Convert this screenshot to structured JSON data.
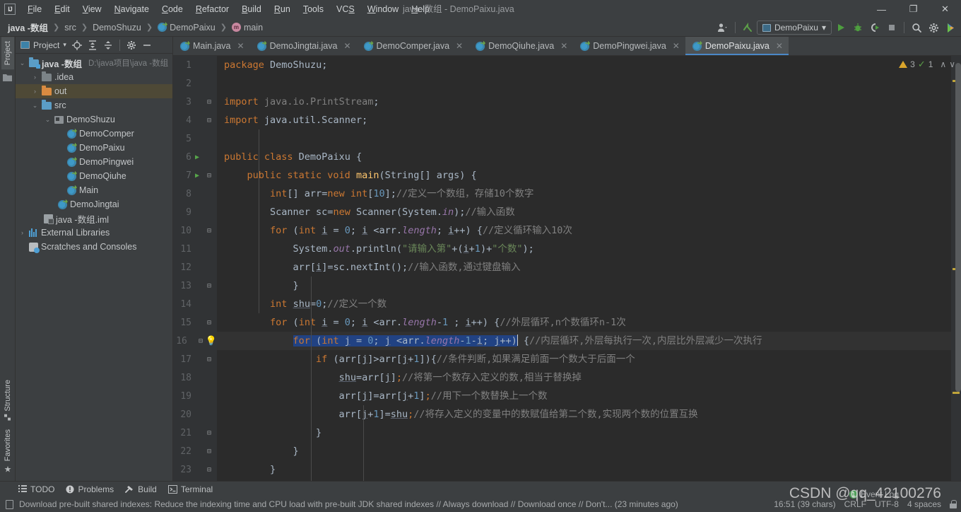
{
  "titlebar": {
    "logo": "IJ",
    "window_title": "java -数组 - DemoPaixu.java",
    "menus": [
      {
        "label": "File",
        "mnemonic": "F"
      },
      {
        "label": "Edit",
        "mnemonic": "E"
      },
      {
        "label": "View",
        "mnemonic": "V"
      },
      {
        "label": "Navigate",
        "mnemonic": "N"
      },
      {
        "label": "Code",
        "mnemonic": "C"
      },
      {
        "label": "Refactor",
        "mnemonic": "R"
      },
      {
        "label": "Build",
        "mnemonic": "B"
      },
      {
        "label": "Run",
        "mnemonic": "R"
      },
      {
        "label": "Tools",
        "mnemonic": "T"
      },
      {
        "label": "VCS",
        "mnemonic": "S"
      },
      {
        "label": "Window",
        "mnemonic": "W"
      },
      {
        "label": "Help",
        "mnemonic": "H"
      }
    ],
    "minimize": "—",
    "maximize": "❐",
    "close": "✕"
  },
  "navbar": {
    "breadcrumbs": [
      {
        "label": "java -数组",
        "icon": "none",
        "bold": true
      },
      {
        "label": "src",
        "icon": "none",
        "bold": false
      },
      {
        "label": "DemoShuzu",
        "icon": "none",
        "bold": false
      },
      {
        "label": "DemoPaixu",
        "icon": "class-icon",
        "bold": false
      },
      {
        "label": "main",
        "icon": "method-icon",
        "bold": false
      }
    ],
    "separator": "❯",
    "run_config": "DemoPaixu",
    "run_config_caret": "▾",
    "icons": [
      "user-avatar-icon",
      "chevron-down-icon",
      "updates-arrow-icon",
      "run-icon",
      "debug-icon",
      "run-coverage-icon",
      "stop-icon",
      "search-everywhere-icon",
      "settings-gear-icon",
      "ide-help-icon"
    ]
  },
  "toolstrip": {
    "top": [
      "Project"
    ],
    "bottom": [
      "Structure",
      "Favorites"
    ]
  },
  "project_panel": {
    "title": "Project",
    "title_caret": "▾",
    "toolbar_icons": [
      "locate-target-icon",
      "expand-all-icon",
      "collapse-all-icon",
      "settings-gear-icon",
      "hide-panel-icon"
    ],
    "tree": [
      {
        "label": "java -数组",
        "path": "D:\\java项目\\java -数组",
        "indent": 0,
        "arrow": "⌄",
        "icon": "module-folder-icon",
        "bold": true,
        "selected": false
      },
      {
        "label": ".idea",
        "path": "",
        "indent": 1,
        "arrow": "›",
        "icon": "folder-icon",
        "bold": false,
        "selected": false
      },
      {
        "label": "out",
        "path": "",
        "indent": 1,
        "arrow": "›",
        "icon": "output-folder-icon",
        "bold": false,
        "selected": true
      },
      {
        "label": "src",
        "path": "",
        "indent": 1,
        "arrow": "⌄",
        "icon": "source-folder-icon",
        "bold": false,
        "selected": false
      },
      {
        "label": "DemoShuzu",
        "path": "",
        "indent": 2,
        "arrow": "⌄",
        "icon": "package-icon",
        "bold": false,
        "selected": false
      },
      {
        "label": "DemoComper",
        "path": "",
        "indent": 3,
        "arrow": "",
        "icon": "class-icon",
        "bold": false,
        "selected": false
      },
      {
        "label": "DemoPaixu",
        "path": "",
        "indent": 3,
        "arrow": "",
        "icon": "class-icon",
        "bold": false,
        "selected": false
      },
      {
        "label": "DemoPingwei",
        "path": "",
        "indent": 3,
        "arrow": "",
        "icon": "class-icon",
        "bold": false,
        "selected": false
      },
      {
        "label": "DemoQiuhe",
        "path": "",
        "indent": 3,
        "arrow": "",
        "icon": "class-icon",
        "bold": false,
        "selected": false
      },
      {
        "label": "Main",
        "path": "",
        "indent": 3,
        "arrow": "",
        "icon": "class-icon",
        "bold": false,
        "selected": false
      },
      {
        "label": "DemoJingtai",
        "path": "",
        "indent": 2,
        "arrow": "",
        "icon": "class-icon",
        "bold": false,
        "selected": false
      },
      {
        "label": "java -数组.iml",
        "path": "",
        "indent": 2,
        "arrow": "",
        "icon": "iml-file-icon",
        "bold": false,
        "selected": false
      },
      {
        "label": "External Libraries",
        "path": "",
        "indent": 0,
        "arrow": "›",
        "icon": "libraries-icon",
        "bold": false,
        "selected": false
      },
      {
        "label": "Scratches and Consoles",
        "path": "",
        "indent": 0,
        "arrow": "",
        "icon": "scratches-icon",
        "bold": false,
        "selected": false
      }
    ]
  },
  "editor": {
    "tabs": [
      {
        "label": "Main.java",
        "active": false
      },
      {
        "label": "DemoJingtai.java",
        "active": false
      },
      {
        "label": "DemoComper.java",
        "active": false
      },
      {
        "label": "DemoQiuhe.java",
        "active": false
      },
      {
        "label": "DemoPingwei.java",
        "active": false
      },
      {
        "label": "DemoPaixu.java",
        "active": true
      }
    ],
    "tab_close": "✕",
    "inspections": {
      "warning_count": "3",
      "ok_count": "1",
      "up_arrow": "∧",
      "down_arrow": "∨"
    },
    "line_numbers": [
      "1",
      "2",
      "3",
      "4",
      "5",
      "6",
      "7",
      "8",
      "9",
      "10",
      "11",
      "12",
      "13",
      "14",
      "15",
      "16",
      "17",
      "18",
      "19",
      "20",
      "21",
      "22",
      "23"
    ],
    "lines": [
      {
        "n": "1",
        "run": false,
        "fold": "",
        "bulb": false,
        "highlight": false
      },
      {
        "n": "2",
        "run": false,
        "fold": "",
        "bulb": false,
        "highlight": false
      },
      {
        "n": "3",
        "run": false,
        "fold": "⊟",
        "bulb": false,
        "highlight": false
      },
      {
        "n": "4",
        "run": false,
        "fold": "⊟",
        "bulb": false,
        "highlight": false
      },
      {
        "n": "5",
        "run": false,
        "fold": "",
        "bulb": false,
        "highlight": false
      },
      {
        "n": "6",
        "run": true,
        "fold": "",
        "bulb": false,
        "highlight": false
      },
      {
        "n": "7",
        "run": true,
        "fold": "⊟",
        "bulb": false,
        "highlight": false
      },
      {
        "n": "8",
        "run": false,
        "fold": "",
        "bulb": false,
        "highlight": false
      },
      {
        "n": "9",
        "run": false,
        "fold": "",
        "bulb": false,
        "highlight": false
      },
      {
        "n": "10",
        "run": false,
        "fold": "⊟",
        "bulb": false,
        "highlight": false
      },
      {
        "n": "11",
        "run": false,
        "fold": "",
        "bulb": false,
        "highlight": false
      },
      {
        "n": "12",
        "run": false,
        "fold": "",
        "bulb": false,
        "highlight": false
      },
      {
        "n": "13",
        "run": false,
        "fold": "⊟",
        "bulb": false,
        "highlight": false
      },
      {
        "n": "14",
        "run": false,
        "fold": "",
        "bulb": false,
        "highlight": false
      },
      {
        "n": "15",
        "run": false,
        "fold": "⊟",
        "bulb": false,
        "highlight": false
      },
      {
        "n": "16",
        "run": false,
        "fold": "⊟",
        "bulb": true,
        "highlight": true
      },
      {
        "n": "17",
        "run": false,
        "fold": "⊟",
        "bulb": false,
        "highlight": false
      },
      {
        "n": "18",
        "run": false,
        "fold": "",
        "bulb": false,
        "highlight": false
      },
      {
        "n": "19",
        "run": false,
        "fold": "",
        "bulb": false,
        "highlight": false
      },
      {
        "n": "20",
        "run": false,
        "fold": "",
        "bulb": false,
        "highlight": false
      },
      {
        "n": "21",
        "run": false,
        "fold": "⊟",
        "bulb": false,
        "highlight": false
      },
      {
        "n": "22",
        "run": false,
        "fold": "⊟",
        "bulb": false,
        "highlight": false
      },
      {
        "n": "23",
        "run": false,
        "fold": "⊟",
        "bulb": false,
        "highlight": false
      }
    ],
    "source_code": [
      "package DemoShuzu;",
      "",
      "import java.io.PrintStream;",
      "import java.util.Scanner;",
      "",
      "public class DemoPaixu {",
      "    public static void main(String[] args) {",
      "        int[] arr=new int[10];//定义一个数组，存储10个数字",
      "        Scanner sc=new Scanner(System.in);//输入函数",
      "        for (int i = 0; i <arr.length; i++) {//定义循环输入10次",
      "            System.out.println(\"请输入第\"+(i+1)+\"个数\");",
      "            arr[i]=sc.nextInt();//输入函数,通过键盘输入",
      "            }",
      "        int shu=0;//定义一个数",
      "        for (int i = 0; i <arr.length-1 ; i++) {//外层循环,n个数循环n-1次",
      "            for (int j = 0; j <arr.length-1-i; j++) {//内层循环,外层每执行一次,内层比外层减少一次执行",
      "                if (arr[j]>arr[j+1]){//条件判断,如果满足前面一个数大于后面一个",
      "                    shu=arr[j];//将第一个数存入定义的数,相当于替换掉",
      "                    arr[j]=arr[j+1];//用下一个数替换上一个数",
      "                    arr[j+1]=shu;//将存入定义的变量中的数赋值给第二个数,实现两个数的位置互换",
      "                }",
      "            }",
      "        }"
    ],
    "selected_text": "for (int j = 0; j <arr.length-1-i; j++)"
  },
  "bottombar": {
    "items": [
      {
        "label": "TODO",
        "icon": "todo-list-icon"
      },
      {
        "label": "Problems",
        "icon": "problems-icon"
      },
      {
        "label": "Build",
        "icon": "build-hammer-icon"
      },
      {
        "label": "Terminal",
        "icon": "terminal-icon"
      }
    ]
  },
  "statusbar": {
    "message": "Download pre-built shared indexes: Reduce the indexing time and CPU load with pre-built JDK shared indexes // Always download // Download once // Don't... (23 minutes ago)",
    "position": "16:51 (39 chars)",
    "line_separator": "CRLF",
    "encoding": "UTF-8",
    "indent": "4 spaces",
    "event_log": "Event Log",
    "event_badge": "1"
  },
  "watermark": "CSDN @qq_42100276",
  "colors": {
    "bg_chrome": "#3c3f41",
    "bg_editor": "#2b2b2b",
    "bg_gutter": "#313335",
    "accent_tab": "#4a88c7",
    "selection": "#214283",
    "tree_selected": "#4e4936",
    "keyword": "#cc7832",
    "string": "#6a8759",
    "number": "#6897bb",
    "comment": "#808080",
    "field": "#9876aa",
    "warning": "#d9a42b",
    "ok": "#5c9e48"
  }
}
